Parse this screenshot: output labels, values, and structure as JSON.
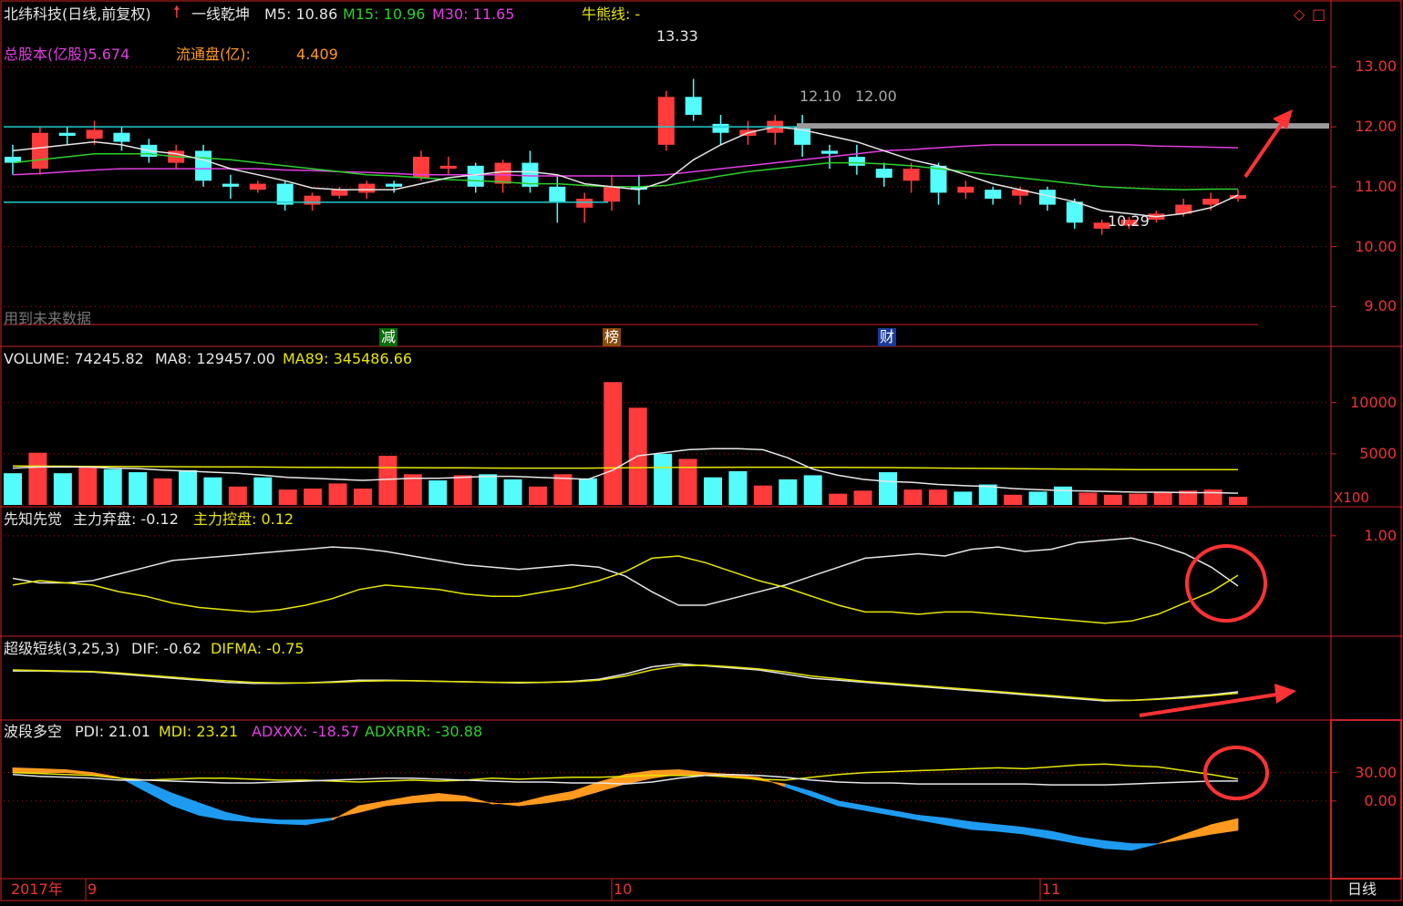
{
  "header": {
    "stock": "北纬科技(日线,前复权)",
    "indicator_name": "一线乾坤",
    "m5_label": "M5: 10.86",
    "m15_label": "M15: 10.96",
    "m30_label": "M30: 11.65",
    "bull_bear_label": "牛熊线: -",
    "total_shares_label": "总股本(亿股)5.674",
    "float_shares_label": "流通盘(亿):",
    "float_shares_value": "4.409",
    "future_data_note": "用到未来数据",
    "flags": [
      "减",
      "榜",
      "财"
    ]
  },
  "volume_header": {
    "volume": "VOLUME: 74245.82",
    "ma8": "MA8: 129457.00",
    "ma89": "MA89: 345486.66",
    "unit": "X100"
  },
  "xzxj_header": {
    "name": "先知先觉",
    "abandon": "主力弃盘: -0.12",
    "control": "主力控盘: 0.12"
  },
  "cjdx_header": {
    "name": "超级短线(3,25,3)",
    "dif": "DIF: -0.62",
    "difma": "DIFMA: -0.75"
  },
  "bdjk_header": {
    "name": "波段多空",
    "pdi": "PDI: 21.01",
    "mdi": "MDI: 23.21",
    "adxxx": "ADXXX: -18.57",
    "adxrrr": "ADXRRR: -30.88"
  },
  "footer": {
    "year": "2017年",
    "months": [
      "9",
      "10",
      "11"
    ],
    "period": "日线"
  },
  "colors": {
    "up": "#ff3b3b",
    "down": "#54fcfc",
    "ma5": "#e6e6e6",
    "ma15": "#2dd02d",
    "ma30": "#e23ee2",
    "yellow": "#e6e600",
    "axis": "#e33",
    "orange": "#ff9a1f",
    "blue": "#1e9bf0"
  },
  "chart_data": [
    {
      "type": "candlestick",
      "ylim": [
        8.7,
        13.6
      ],
      "yticks": [
        "13.00",
        "12.00",
        "11.00",
        "10.00",
        "9.00"
      ],
      "ytick_values": [
        13,
        12,
        11,
        10,
        9
      ],
      "annotations": {
        "high_label": "13.33",
        "low_label": "10.29",
        "level_labels": [
          "12.10",
          "12.00"
        ]
      },
      "candles": [
        [
          11.5,
          11.4,
          11.7,
          11.2
        ],
        [
          11.3,
          11.9,
          12.0,
          11.2
        ],
        [
          11.9,
          11.85,
          12.0,
          11.7
        ],
        [
          11.8,
          11.95,
          12.1,
          11.7
        ],
        [
          11.9,
          11.75,
          12.0,
          11.6
        ],
        [
          11.7,
          11.5,
          11.8,
          11.4
        ],
        [
          11.4,
          11.6,
          11.7,
          11.3
        ],
        [
          11.6,
          11.1,
          11.7,
          11.0
        ],
        [
          11.05,
          11.0,
          11.2,
          10.8
        ],
        [
          10.95,
          11.05,
          11.1,
          10.9
        ],
        [
          11.05,
          10.7,
          11.1,
          10.6
        ],
        [
          10.7,
          10.85,
          10.9,
          10.6
        ],
        [
          10.85,
          10.95,
          11.0,
          10.8
        ],
        [
          10.9,
          11.05,
          11.1,
          10.8
        ],
        [
          11.05,
          11.0,
          11.1,
          10.9
        ],
        [
          11.15,
          11.5,
          11.6,
          11.1
        ],
        [
          11.3,
          11.35,
          11.5,
          11.2
        ],
        [
          11.35,
          11.0,
          11.4,
          10.9
        ],
        [
          11.05,
          11.4,
          11.45,
          10.9
        ],
        [
          11.4,
          11.0,
          11.6,
          10.9
        ],
        [
          11.0,
          10.75,
          11.2,
          10.4
        ],
        [
          10.65,
          10.8,
          10.9,
          10.4
        ],
        [
          10.75,
          11.0,
          11.2,
          10.6
        ],
        [
          11.0,
          10.95,
          11.2,
          10.7
        ],
        [
          11.7,
          12.5,
          12.6,
          11.6
        ],
        [
          12.5,
          12.2,
          12.8,
          12.1
        ],
        [
          12.05,
          11.9,
          12.2,
          11.7
        ],
        [
          11.85,
          11.95,
          12.1,
          11.7
        ],
        [
          11.9,
          12.1,
          12.2,
          11.7
        ],
        [
          12.0,
          11.7,
          12.2,
          11.5
        ],
        [
          11.6,
          11.55,
          11.7,
          11.3
        ],
        [
          11.5,
          11.35,
          11.7,
          11.2
        ],
        [
          11.3,
          11.15,
          11.4,
          11.0
        ],
        [
          11.1,
          11.3,
          11.4,
          10.9
        ],
        [
          11.35,
          10.9,
          11.4,
          10.7
        ],
        [
          10.9,
          11.0,
          11.1,
          10.8
        ],
        [
          10.95,
          10.8,
          11.0,
          10.7
        ],
        [
          10.85,
          10.95,
          11.0,
          10.7
        ],
        [
          10.95,
          10.7,
          11.0,
          10.6
        ],
        [
          10.75,
          10.4,
          10.8,
          10.3
        ],
        [
          10.3,
          10.4,
          10.45,
          10.2
        ],
        [
          10.35,
          10.45,
          10.5,
          10.3
        ],
        [
          10.45,
          10.55,
          10.6,
          10.4
        ],
        [
          10.55,
          10.7,
          10.8,
          10.5
        ],
        [
          10.7,
          10.8,
          10.9,
          10.6
        ],
        [
          10.8,
          10.86,
          10.95,
          10.75
        ]
      ],
      "ma5": [
        11.6,
        11.65,
        11.7,
        11.75,
        11.7,
        11.6,
        11.55,
        11.45,
        11.3,
        11.2,
        11.1,
        10.98,
        10.95,
        10.95,
        10.95,
        11.05,
        11.15,
        11.2,
        11.25,
        11.25,
        11.2,
        11.05,
        11.0,
        10.95,
        11.1,
        11.45,
        11.7,
        11.9,
        12.0,
        11.95,
        11.85,
        11.75,
        11.6,
        11.45,
        11.35,
        11.2,
        11.05,
        10.95,
        10.85,
        10.75,
        10.6,
        10.55,
        10.5,
        10.55,
        10.65,
        10.86
      ],
      "ma15": [
        11.4,
        11.45,
        11.5,
        11.55,
        11.55,
        11.55,
        11.5,
        11.48,
        11.45,
        11.4,
        11.35,
        11.3,
        11.25,
        11.2,
        11.18,
        11.15,
        11.12,
        11.1,
        11.08,
        11.05,
        11.05,
        11.02,
        11.0,
        11.0,
        11.02,
        11.1,
        11.18,
        11.25,
        11.3,
        11.35,
        11.4,
        11.4,
        11.38,
        11.35,
        11.3,
        11.25,
        11.2,
        11.15,
        11.1,
        11.05,
        11.0,
        10.98,
        10.96,
        10.95,
        10.96,
        10.96
      ],
      "ma30": [
        11.2,
        11.22,
        11.25,
        11.28,
        11.3,
        11.3,
        11.3,
        11.3,
        11.3,
        11.3,
        11.28,
        11.27,
        11.25,
        11.24,
        11.22,
        11.2,
        11.2,
        11.2,
        11.2,
        11.18,
        11.18,
        11.18,
        11.18,
        11.18,
        11.2,
        11.25,
        11.3,
        11.35,
        11.4,
        11.45,
        11.5,
        11.55,
        11.6,
        11.62,
        11.65,
        11.68,
        11.7,
        11.7,
        11.7,
        11.7,
        11.7,
        11.7,
        11.68,
        11.67,
        11.66,
        11.65
      ]
    },
    {
      "type": "bar",
      "name": "volume",
      "ylim": [
        0,
        13000
      ],
      "yticks": [
        "10000",
        "5000"
      ],
      "ytick_values": [
        10000,
        5000
      ],
      "values": [
        3100,
        5100,
        3100,
        3700,
        3500,
        3200,
        2600,
        3400,
        2700,
        1800,
        2700,
        1500,
        1600,
        2100,
        1600,
        4800,
        3000,
        2400,
        2900,
        3000,
        2500,
        1800,
        3000,
        2600,
        12000,
        9500,
        5000,
        4500,
        2700,
        3300,
        1900,
        2500,
        2900,
        1100,
        1400,
        3200,
        1500,
        1500,
        1300,
        2000,
        1000,
        1300,
        1800,
        1200,
        1000,
        1100,
        1200,
        1400,
        1500,
        800
      ],
      "up": [
        false,
        true,
        false,
        true,
        false,
        false,
        true,
        false,
        false,
        true,
        false,
        true,
        true,
        true,
        true,
        true,
        true,
        false,
        true,
        false,
        false,
        true,
        true,
        false,
        true,
        true,
        false,
        true,
        false,
        false,
        true,
        false,
        false,
        true,
        true,
        false,
        true,
        true,
        false,
        false,
        true,
        false,
        false,
        true,
        true,
        true,
        true,
        true,
        true,
        true
      ],
      "ma8": [
        3600,
        3700,
        3700,
        3700,
        3600,
        3550,
        3400,
        3300,
        3200,
        3100,
        2900,
        2700,
        2600,
        2500,
        2400,
        2500,
        2600,
        2600,
        2700,
        2800,
        2800,
        2700,
        2600,
        2500,
        3400,
        4800,
        5100,
        5400,
        5500,
        5500,
        5400,
        4600,
        3500,
        2900,
        2500,
        2300,
        2200,
        2000,
        1900,
        1800,
        1600,
        1500,
        1400,
        1350,
        1300,
        1250,
        1250,
        1200,
        1200,
        1150
      ],
      "ma89": [
        3800,
        3790,
        3780,
        3770,
        3760,
        3750,
        3740,
        3730,
        3720,
        3710,
        3700,
        3690,
        3680,
        3670,
        3660,
        3650,
        3640,
        3630,
        3620,
        3610,
        3600,
        3600,
        3600,
        3600,
        3620,
        3640,
        3660,
        3670,
        3680,
        3690,
        3690,
        3690,
        3680,
        3670,
        3660,
        3650,
        3630,
        3610,
        3590,
        3570,
        3550,
        3530,
        3510,
        3490,
        3470,
        3450,
        3450,
        3450,
        3450,
        3450
      ]
    },
    {
      "type": "line",
      "name": "先知先觉",
      "ylim": [
        -1.2,
        1.2
      ],
      "yticks": [
        "1.00"
      ],
      "ytick_values": [
        1.0
      ],
      "series": [
        {
          "name": "主力弃盘",
          "values": [
            0.05,
            -0.05,
            -0.05,
            0.0,
            0.15,
            0.3,
            0.45,
            0.5,
            0.55,
            0.6,
            0.65,
            0.7,
            0.75,
            0.72,
            0.65,
            0.55,
            0.45,
            0.35,
            0.3,
            0.25,
            0.3,
            0.35,
            0.3,
            0.1,
            -0.25,
            -0.55,
            -0.55,
            -0.4,
            -0.25,
            -0.1,
            0.1,
            0.3,
            0.5,
            0.55,
            0.6,
            0.55,
            0.7,
            0.75,
            0.65,
            0.7,
            0.85,
            0.9,
            0.95,
            0.8,
            0.6,
            0.3,
            -0.12
          ]
        },
        {
          "name": "主力控盘",
          "values": [
            -0.1,
            0.0,
            -0.05,
            -0.1,
            -0.25,
            -0.35,
            -0.5,
            -0.6,
            -0.65,
            -0.7,
            -0.65,
            -0.55,
            -0.4,
            -0.2,
            -0.1,
            -0.15,
            -0.2,
            -0.3,
            -0.35,
            -0.35,
            -0.25,
            -0.15,
            0.0,
            0.2,
            0.5,
            0.55,
            0.4,
            0.2,
            0.0,
            -0.15,
            -0.35,
            -0.55,
            -0.7,
            -0.7,
            -0.75,
            -0.7,
            -0.7,
            -0.75,
            -0.8,
            -0.85,
            -0.9,
            -0.95,
            -0.9,
            -0.75,
            -0.5,
            -0.25,
            0.12
          ]
        }
      ]
    },
    {
      "type": "line",
      "name": "超级短线",
      "ylim": [
        -3,
        3
      ],
      "yticks": [],
      "ytick_values": [],
      "series": [
        {
          "name": "DIF",
          "values": [
            1.4,
            1.4,
            1.35,
            1.3,
            1.1,
            0.9,
            0.7,
            0.5,
            0.3,
            0.2,
            0.2,
            0.25,
            0.35,
            0.5,
            0.5,
            0.45,
            0.4,
            0.35,
            0.3,
            0.25,
            0.3,
            0.4,
            0.6,
            1.1,
            1.8,
            2.1,
            1.9,
            1.7,
            1.5,
            1.1,
            0.7,
            0.5,
            0.3,
            0.1,
            -0.1,
            -0.3,
            -0.5,
            -0.7,
            -0.9,
            -1.1,
            -1.3,
            -1.5,
            -1.45,
            -1.3,
            -1.1,
            -0.9,
            -0.62
          ]
        },
        {
          "name": "DIFMA",
          "values": [
            1.5,
            1.45,
            1.4,
            1.35,
            1.2,
            1.0,
            0.8,
            0.6,
            0.45,
            0.3,
            0.25,
            0.25,
            0.3,
            0.4,
            0.45,
            0.45,
            0.4,
            0.35,
            0.3,
            0.3,
            0.3,
            0.35,
            0.5,
            0.9,
            1.5,
            1.9,
            1.95,
            1.8,
            1.6,
            1.3,
            0.9,
            0.65,
            0.4,
            0.2,
            0.0,
            -0.2,
            -0.4,
            -0.6,
            -0.8,
            -1.0,
            -1.2,
            -1.4,
            -1.45,
            -1.35,
            -1.2,
            -1.0,
            -0.75
          ]
        }
      ]
    },
    {
      "type": "line",
      "name": "波段多空",
      "ylim": [
        -80,
        70
      ],
      "yticks": [
        "30.00",
        "0.00"
      ],
      "ytick_values": [
        30,
        0
      ],
      "series": [
        {
          "name": "PDI",
          "values": [
            28,
            26,
            25,
            24,
            22,
            22,
            21,
            20,
            19,
            19,
            20,
            21,
            22,
            23,
            24,
            24,
            23,
            22,
            21,
            20,
            20,
            19,
            19,
            18,
            20,
            24,
            27,
            28,
            27,
            25,
            22,
            20,
            19,
            19,
            18,
            18,
            18,
            18,
            18,
            17,
            17,
            17,
            18,
            19,
            20,
            21,
            21.01
          ]
        },
        {
          "name": "MDI",
          "values": [
            30,
            29,
            28,
            27,
            24,
            22,
            23,
            24,
            24,
            23,
            22,
            22,
            21,
            20,
            21,
            22,
            21,
            22,
            24,
            23,
            24,
            25,
            25,
            26,
            27,
            27,
            27,
            25,
            23,
            22,
            25,
            28,
            30,
            31,
            32,
            33,
            34,
            35,
            34,
            36,
            38,
            39,
            37,
            36,
            32,
            28,
            23.21
          ]
        },
        {
          "name": "ADXXX",
          "values": [
            35,
            34,
            33,
            30,
            25,
            10,
            -5,
            -15,
            -20,
            -22,
            -24,
            -25,
            -20,
            -5,
            0,
            5,
            8,
            5,
            -3,
            -2,
            5,
            10,
            20,
            28,
            32,
            33,
            30,
            28,
            25,
            15,
            5,
            -5,
            -10,
            -15,
            -20,
            -25,
            -30,
            -32,
            -35,
            -40,
            -45,
            -50,
            -52,
            -45,
            -35,
            -25,
            -18.57
          ]
        },
        {
          "name": "ADXRRR",
          "values": [
            30,
            30,
            30,
            28,
            24,
            20,
            8,
            -2,
            -12,
            -18,
            -20,
            -20,
            -18,
            -12,
            -5,
            -2,
            0,
            0,
            -2,
            -5,
            -2,
            2,
            10,
            18,
            24,
            28,
            28,
            26,
            22,
            18,
            10,
            0,
            -5,
            -10,
            -15,
            -18,
            -22,
            -25,
            -28,
            -32,
            -38,
            -42,
            -45,
            -45,
            -40,
            -35,
            -30.88
          ]
        }
      ]
    }
  ]
}
